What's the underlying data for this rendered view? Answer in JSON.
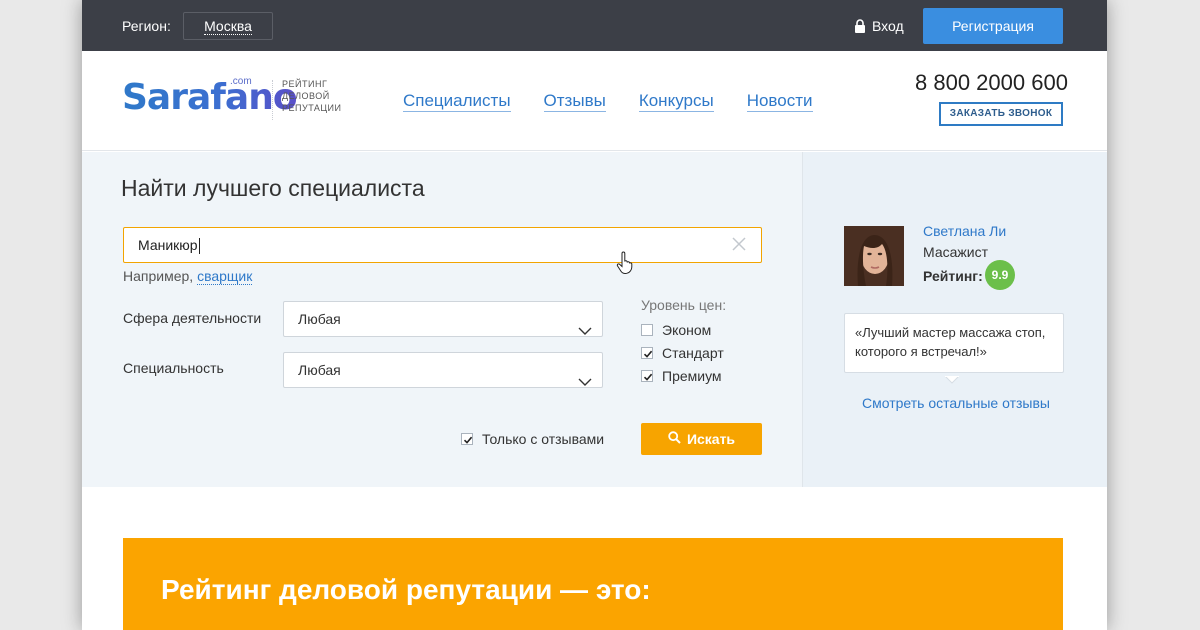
{
  "topbar": {
    "region_label": "Регион:",
    "region_value": "Москва",
    "login_label": "Вход",
    "register_label": "Регистрация",
    "accent_color": "#3a8ee0"
  },
  "header": {
    "logo": {
      "name": "Sarafano",
      "suffix": ".com",
      "tagline": "РЕЙТИНГ ДЕЛОВОЙ РЕПУТАЦИИ"
    },
    "nav": [
      {
        "label": "Специалисты"
      },
      {
        "label": "Отзывы"
      },
      {
        "label": "Конкурсы"
      },
      {
        "label": "Новости"
      }
    ],
    "phone": "8 800 2000 600",
    "callback_label": "ЗАКАЗАТЬ ЗВОНОК"
  },
  "search": {
    "title": "Найти лучшего специалиста",
    "query": "Маникюр",
    "example_prefix": "Например,",
    "example_link": "сварщик",
    "fields": [
      {
        "label": "Сфера деятельности",
        "value": "Любая"
      },
      {
        "label": "Специальность",
        "value": "Любая"
      }
    ],
    "price_level_label": "Уровень цен:",
    "price_levels": [
      {
        "label": "Эконом",
        "checked": false
      },
      {
        "label": "Стандарт",
        "checked": true
      },
      {
        "label": "Премиум",
        "checked": true
      }
    ],
    "with_reviews_label": "Только с отзывами",
    "with_reviews_checked": true,
    "search_button_label": "Искать",
    "button_color": "#f7a400"
  },
  "review": {
    "name": "Светлана Ли",
    "role": "Масажист",
    "rating_label": "Рейтинг:",
    "rating_value": "9.9",
    "rating_color": "#6bbf4a",
    "quote": "«Лучший мастер массажа стоп, которого я встречал!»",
    "more_link": "Смотреть остальные отзывы"
  },
  "banner": {
    "title": "Рейтинг деловой репутации — это:",
    "color": "#fba400"
  }
}
